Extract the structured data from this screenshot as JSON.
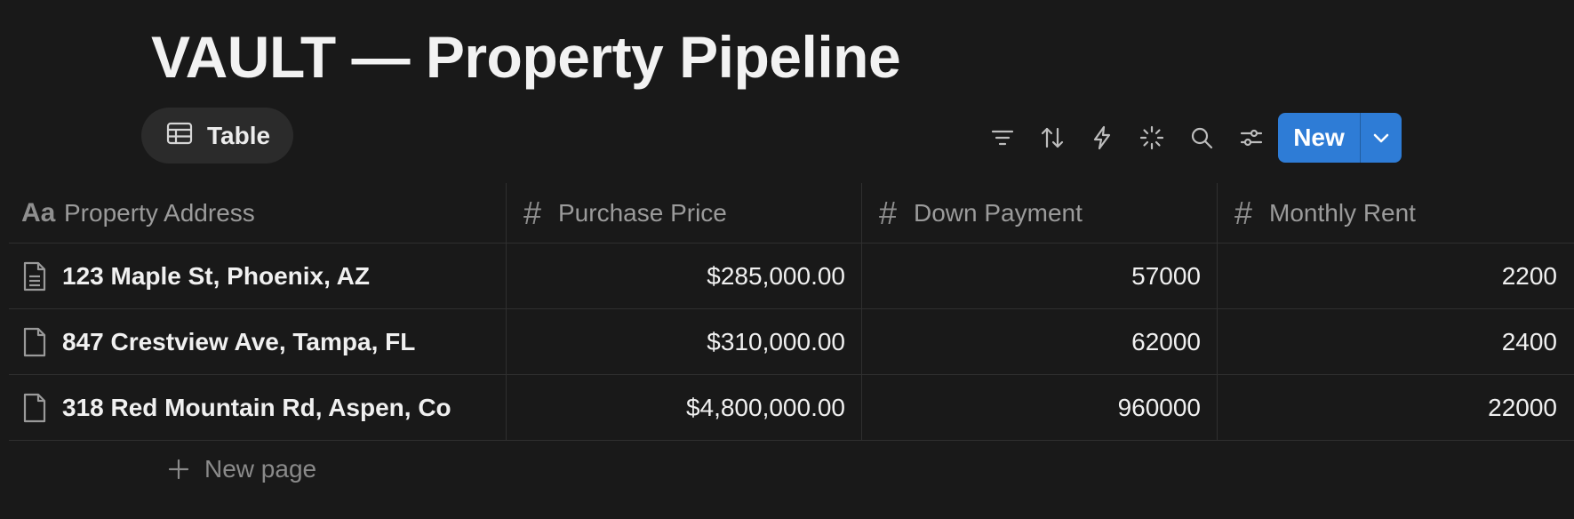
{
  "page": {
    "title": "VAULT — Property Pipeline"
  },
  "view_tab": {
    "icon": "table-icon",
    "label": "Table"
  },
  "toolbar": {
    "tools": [
      "filter-icon",
      "sort-icon",
      "automation-bolt-icon",
      "ai-sparkle-icon",
      "search-icon",
      "settings-sliders-icon"
    ],
    "new_label": "New",
    "new_caret_icon": "chevron-down-icon",
    "accent_color": "#2e7cd6"
  },
  "table": {
    "columns": [
      {
        "icon": "text-property-icon",
        "icon_text": "Aa",
        "label": "Property Address"
      },
      {
        "icon": "number-property-icon",
        "icon_text": "#",
        "label": "Purchase Price"
      },
      {
        "icon": "number-property-icon",
        "icon_text": "#",
        "label": "Down Payment"
      },
      {
        "icon": "number-property-icon",
        "icon_text": "#",
        "label": "Monthly Rent"
      }
    ],
    "rows": [
      {
        "address": "123 Maple St, Phoenix, AZ",
        "purchase_price": "$285,000.00",
        "down_payment": "57000",
        "monthly_rent": "2200",
        "page_icon": "document-with-text-icon"
      },
      {
        "address": "847 Crestview Ave, Tampa, FL",
        "purchase_price": "$310,000.00",
        "down_payment": "62000",
        "monthly_rent": "2400",
        "page_icon": "document-icon"
      },
      {
        "address": "318 Red Mountain Rd, Aspen, Co",
        "purchase_price": "$4,800,000.00",
        "down_payment": "960000",
        "monthly_rent": "22000",
        "page_icon": "document-icon"
      }
    ]
  },
  "new_page": {
    "icon": "plus-icon",
    "label": "New page"
  }
}
